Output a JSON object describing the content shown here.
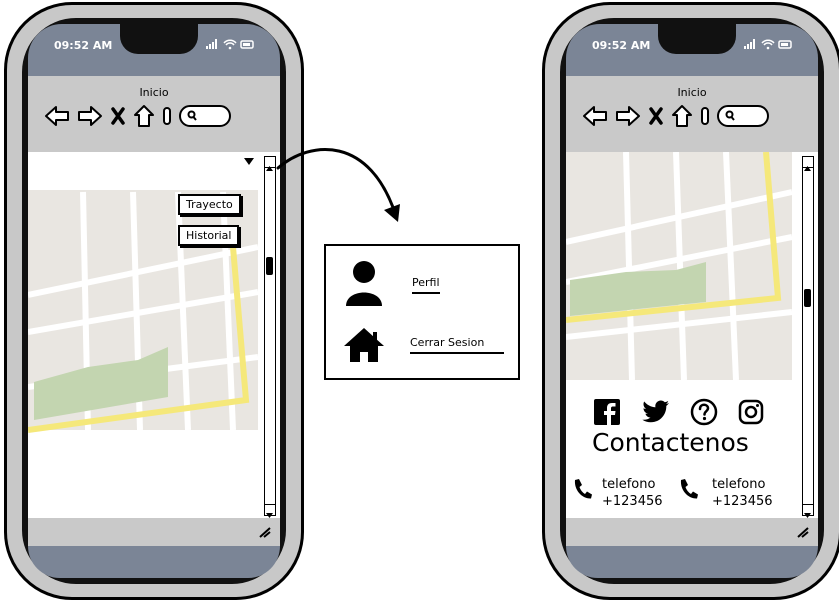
{
  "left_phone": {
    "status_time": "09:52 AM",
    "toolbar_title": "Inicio",
    "map_buttons": [
      "Trayecto",
      "Historial"
    ]
  },
  "menu_popup": {
    "items": [
      {
        "label": "Perfil",
        "icon": "user-icon"
      },
      {
        "label": "Cerrar Sesion",
        "icon": "home-icon"
      }
    ]
  },
  "right_phone": {
    "status_time": "09:52 AM",
    "toolbar_title": "Inicio",
    "social_icons": [
      "facebook-icon",
      "twitter-icon",
      "help-icon",
      "instagram-icon"
    ],
    "contact_title": "Contactenos",
    "contacts": [
      {
        "label": "telefono",
        "number": "+123456"
      },
      {
        "label": "telefono",
        "number": "+123456"
      }
    ]
  },
  "colors": {
    "phone_body": "#c8c8c8",
    "status_bar": "#7b8596",
    "toolbar": "#c9c9c9",
    "map_ground": "#e9e6e1",
    "map_road": "#ffffff",
    "map_route": "#f5e87a",
    "map_park": "#c3d5b0"
  }
}
